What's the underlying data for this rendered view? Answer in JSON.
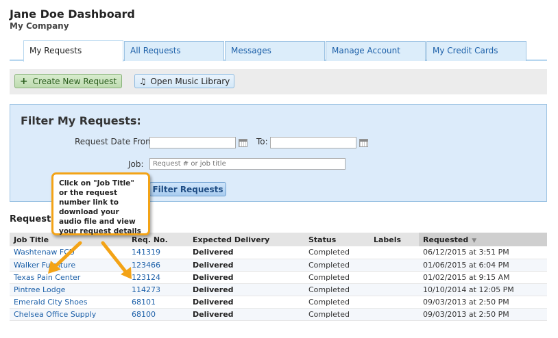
{
  "header": {
    "title": "Jane Doe Dashboard",
    "company": "My Company"
  },
  "tabs": [
    {
      "label": "My Requests",
      "active": true
    },
    {
      "label": "All Requests",
      "active": false
    },
    {
      "label": "Messages",
      "active": false
    },
    {
      "label": "Manage Account",
      "active": false
    },
    {
      "label": "My Credit Cards",
      "active": false
    }
  ],
  "toolbar": {
    "create_label": "Create New Request",
    "music_label": "Open Music Library",
    "create_icon": "plus-icon",
    "music_icon": "music-note-icon"
  },
  "filter": {
    "title": "Filter My Requests:",
    "date_from_label": "Request Date From:",
    "date_from_value": "",
    "to_label": "To:",
    "to_value": "",
    "job_label": "Job:",
    "job_placeholder": "Request # or job title",
    "button_label": "Filter Requests"
  },
  "callout": {
    "text": "Click on \"Job Title\" or the request number link to download your audio file and view your request details"
  },
  "requests": {
    "label": "Requests:",
    "columns": [
      "Job Title",
      "Req. No.",
      "Expected Delivery",
      "Status",
      "Labels",
      "Requested"
    ],
    "rows": [
      [
        "Washtenaw FCU",
        "141319",
        "Delivered",
        "Completed",
        "",
        "06/12/2015 at 3:51 PM"
      ],
      [
        "Walker Furniture",
        "123466",
        "Delivered",
        "Completed",
        "",
        "01/06/2015 at 6:04 PM"
      ],
      [
        "Texas Pain Center",
        "123124",
        "Delivered",
        "Completed",
        "",
        "01/02/2015 at 9:15 AM"
      ],
      [
        "Pintree Lodge",
        "114273",
        "Delivered",
        "Completed",
        "",
        "10/10/2014 at 12:05 PM"
      ],
      [
        "Emerald City Shoes",
        "68101",
        "Delivered",
        "Completed",
        "",
        "09/03/2013 at 2:50 PM"
      ],
      [
        "Chelsea Office Supply",
        "68100",
        "Delivered",
        "Completed",
        "",
        "09/03/2013 at 2:50 PM"
      ]
    ]
  },
  "colors": {
    "accent": "#1b5fa8",
    "callout_border": "#f3a316",
    "filter_bg": "#dcebfa"
  }
}
